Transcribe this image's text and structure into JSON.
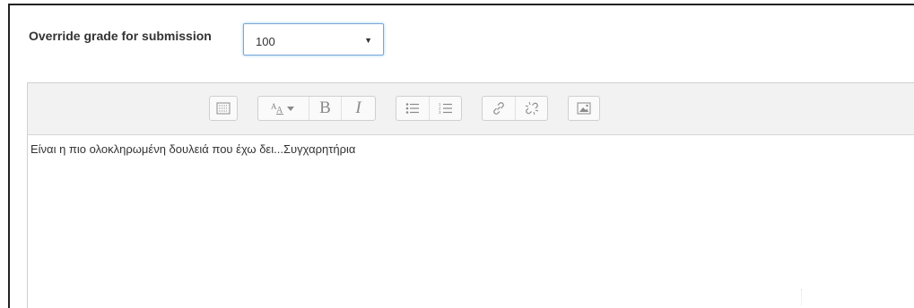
{
  "grade": {
    "label": "Override grade for submission",
    "selected_value": "100"
  },
  "editor": {
    "content": "Είναι η πιο ολοκληρωμένη δουλειά που έχω δει...Συγχαρητήρια",
    "toolbar": {
      "groups": [
        {
          "buttons": [
            "toolbar-toggle-icon"
          ]
        },
        {
          "buttons": [
            "font-style-icon",
            "bold-icon",
            "italic-icon"
          ]
        },
        {
          "buttons": [
            "unordered-list-icon",
            "ordered-list-icon"
          ]
        },
        {
          "buttons": [
            "link-icon",
            "unlink-icon"
          ]
        },
        {
          "buttons": [
            "image-icon"
          ]
        }
      ],
      "bold_glyph": "B",
      "italic_glyph": "I"
    }
  },
  "colors": {
    "select_focus_border": "#7aa7d8",
    "toolbar_background": "#f2f2f2",
    "icon_color": "#888888",
    "text_color": "#333333"
  }
}
